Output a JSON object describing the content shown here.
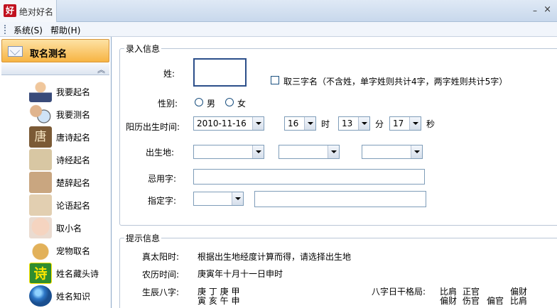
{
  "window": {
    "title": "绝对好名",
    "logo_text": "好",
    "minimize_glyph": "–",
    "close_glyph": "×"
  },
  "menu": {
    "items": [
      "系统(S)",
      "帮助(H)"
    ]
  },
  "sidebar": {
    "header": "取名测名",
    "collapse_glyph": "︽",
    "items": [
      {
        "label": "我要起名",
        "icon": "person-icon"
      },
      {
        "label": "我要测名",
        "icon": "magnifier-person-icon"
      },
      {
        "label": "唐诗起名",
        "icon": "tang-icon",
        "glyph": "唐"
      },
      {
        "label": "诗经起名",
        "icon": "shijing-icon"
      },
      {
        "label": "楚辞起名",
        "icon": "chuci-icon"
      },
      {
        "label": "论语起名",
        "icon": "lunyu-icon"
      },
      {
        "label": "取小名",
        "icon": "baby-icon"
      },
      {
        "label": "宠物取名",
        "icon": "dog-icon"
      },
      {
        "label": "姓名藏头诗",
        "icon": "poem-icon",
        "glyph": "诗"
      },
      {
        "label": "姓名知识",
        "icon": "globe-icon"
      }
    ]
  },
  "input_group": {
    "title": "录入信息",
    "surname_label": "姓:",
    "surname_value": "",
    "three_char_label": "取三字名（不含姓，单字姓则共计4字，两字姓则共计5字）",
    "three_char_checked": false,
    "gender_label": "性别:",
    "gender_male": "男",
    "gender_female": "女",
    "birth_time_label": "阳历出生时间:",
    "date_value": "2010-11-16",
    "hour_value": "16",
    "hour_unit": "时",
    "minute_value": "13",
    "minute_unit": "分",
    "second_value": "17",
    "second_unit": "秒",
    "birthplace_label": "出生地:",
    "taboo_label": "忌用字:",
    "taboo_value": "",
    "specified_label": "指定字:",
    "specified_value": ""
  },
  "hint_group": {
    "title": "提示信息",
    "solar_label": "真太阳时:",
    "solar_value": "根据出生地经度计算而得，请选择出生地",
    "lunar_label": "农历时间:",
    "lunar_value": "庚寅年十月十一日申时",
    "bazi_label": "生辰八字:",
    "bazi_stems": "庚 丁 庚 甲",
    "bazi_branches": "寅 亥 午 申",
    "daystem_label": "八字日干格局:",
    "pattern_top": [
      "比肩",
      "正官",
      "",
      "偏财"
    ],
    "pattern_bottom": [
      "偏财",
      "伤官",
      "偏官",
      "比肩"
    ]
  },
  "colors": {
    "sidebar_header": "#f7b443",
    "title_bar": "#c8d8ec",
    "border": "#7f9db9"
  }
}
